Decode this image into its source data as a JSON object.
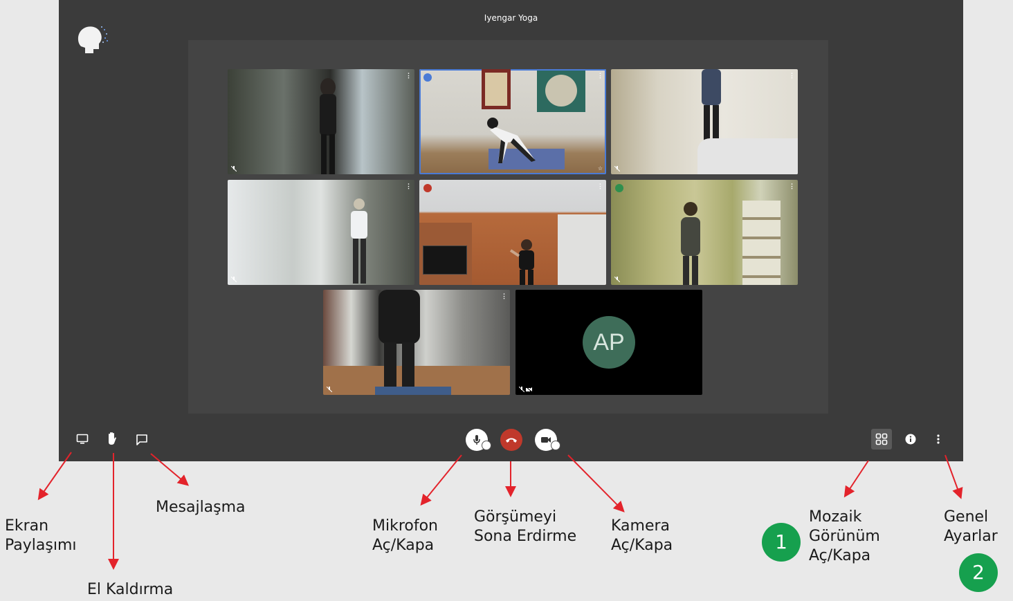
{
  "meeting": {
    "title": "Iyengar Yoga"
  },
  "participants": [
    {
      "id": "p1",
      "scene": "room-window-dark",
      "muted": true
    },
    {
      "id": "p2",
      "scene": "yoga-instructor",
      "muted": false,
      "active_speaker": true
    },
    {
      "id": "p3",
      "scene": "room-sofa",
      "muted": true
    },
    {
      "id": "p4",
      "scene": "room-curtains",
      "muted": true
    },
    {
      "id": "p5",
      "scene": "room-tv",
      "muted": false,
      "speaking": true
    },
    {
      "id": "p6",
      "scene": "room-bookshelf",
      "muted": true
    },
    {
      "id": "p7",
      "scene": "room-closeup-legs",
      "muted": true
    },
    {
      "id": "p8",
      "scene": "camera-off",
      "muted": true,
      "camera_off": true,
      "initials": "AP"
    }
  ],
  "toolbar": {
    "left": [
      "screen-share-icon",
      "raise-hand-icon",
      "chat-icon"
    ],
    "center": [
      "microphone-icon",
      "hangup-icon",
      "camera-icon"
    ],
    "right": [
      "tile-view-icon",
      "info-icon",
      "more-vertical-icon"
    ]
  },
  "annotations": {
    "screen_share": "Ekran\nPaylaşımı",
    "raise_hand": "El Kaldırma",
    "chat": "Mesajlaşma",
    "mic": "Mikrofon\nAç/Kapa",
    "end_call": "Görşümeyi\nSona Erdirme",
    "camera": "Kamera\nAç/Kapa",
    "tile_view": "Mozaik\nGörünüm\nAç/Kapa",
    "settings": "Genel\nAyarlar",
    "badge_1": "1",
    "badge_2": "2"
  },
  "colors": {
    "app_bg": "#3b3b3b",
    "stage_bg": "#444444",
    "hangup_red": "#c0392b",
    "active_speaker_border": "#4a7bd6",
    "avatar_green": "#3e6d59",
    "annotation_arrow": "#e3232b",
    "badge_green": "#16a04e"
  }
}
